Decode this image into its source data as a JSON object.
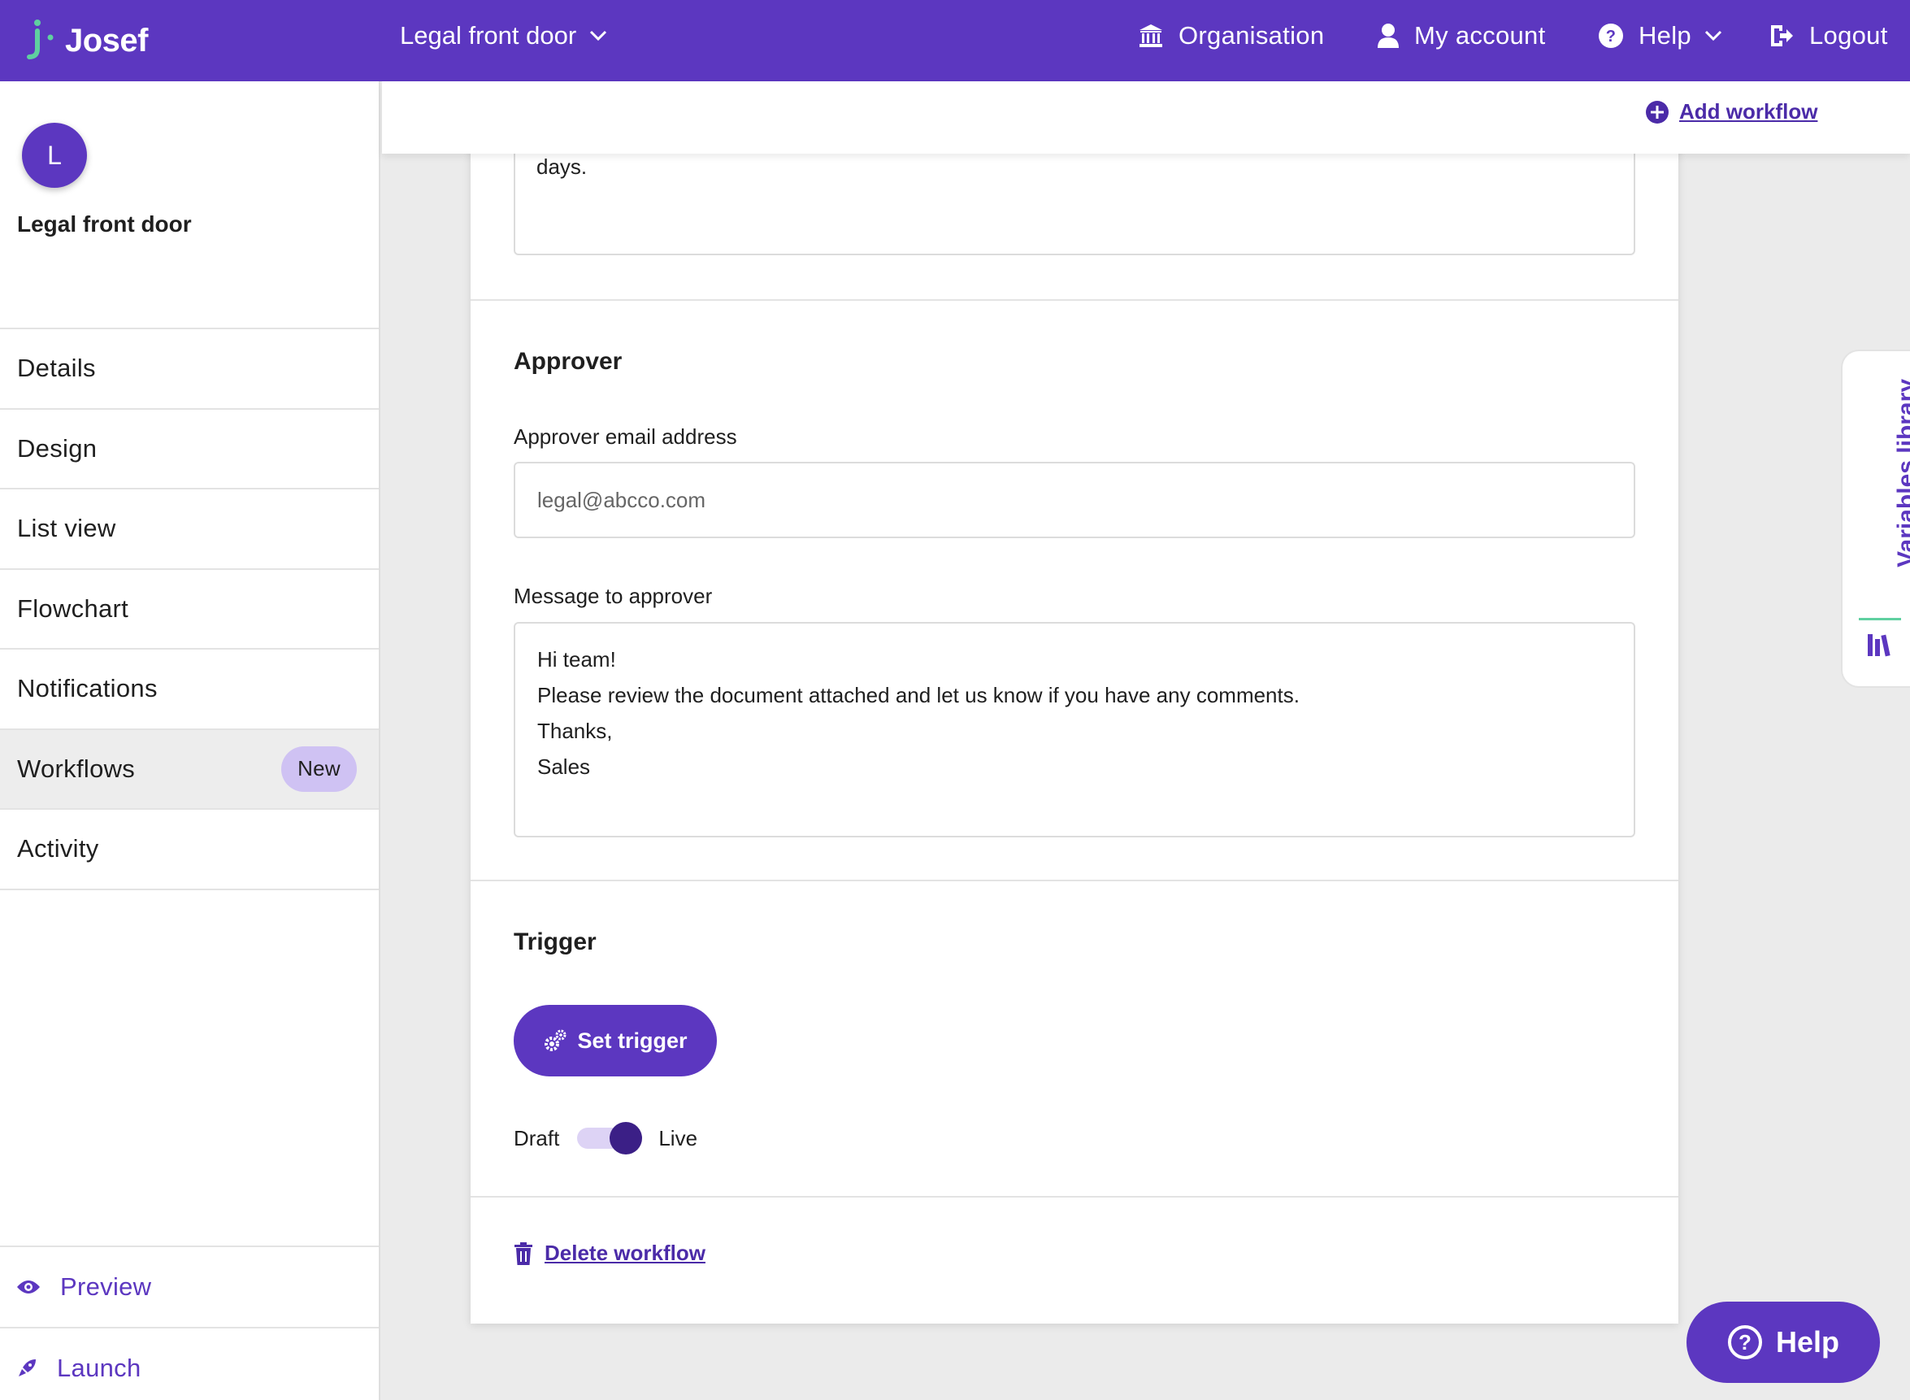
{
  "app": {
    "brand": "Josef",
    "accent": "#5c37c0"
  },
  "topbar": {
    "project_select": "Legal front door",
    "nav": {
      "organisation": "Organisation",
      "account": "My account",
      "help": "Help",
      "logout": "Logout"
    }
  },
  "sidebar": {
    "avatar_letter": "L",
    "project_name": "Legal front door",
    "items": [
      {
        "label": "Details"
      },
      {
        "label": "Design"
      },
      {
        "label": "List view"
      },
      {
        "label": "Flowchart"
      },
      {
        "label": "Notifications"
      },
      {
        "label": "Workflows",
        "badge": "New",
        "active": true
      },
      {
        "label": "Activity"
      }
    ],
    "preview": "Preview",
    "launch": "Launch"
  },
  "actionbar": {
    "add_workflow": "Add workflow"
  },
  "card": {
    "previous_text_tail": "days.",
    "approver": {
      "title": "Approver",
      "email_label": "Approver email address",
      "email_placeholder": "legal@abcco.com",
      "message_label": "Message to approver",
      "message_lines": [
        "Hi team!",
        "Please review the document attached and let us know if you have any comments.",
        "Thanks,",
        "Sales"
      ]
    },
    "trigger": {
      "title": "Trigger",
      "set_trigger": "Set trigger",
      "toggle_off_label": "Draft",
      "toggle_on_label": "Live",
      "toggle_state": "Live"
    },
    "delete_workflow": "Delete workflow"
  },
  "variables_tab": {
    "label": "Variables library"
  },
  "floating_help": {
    "label": "Help"
  }
}
